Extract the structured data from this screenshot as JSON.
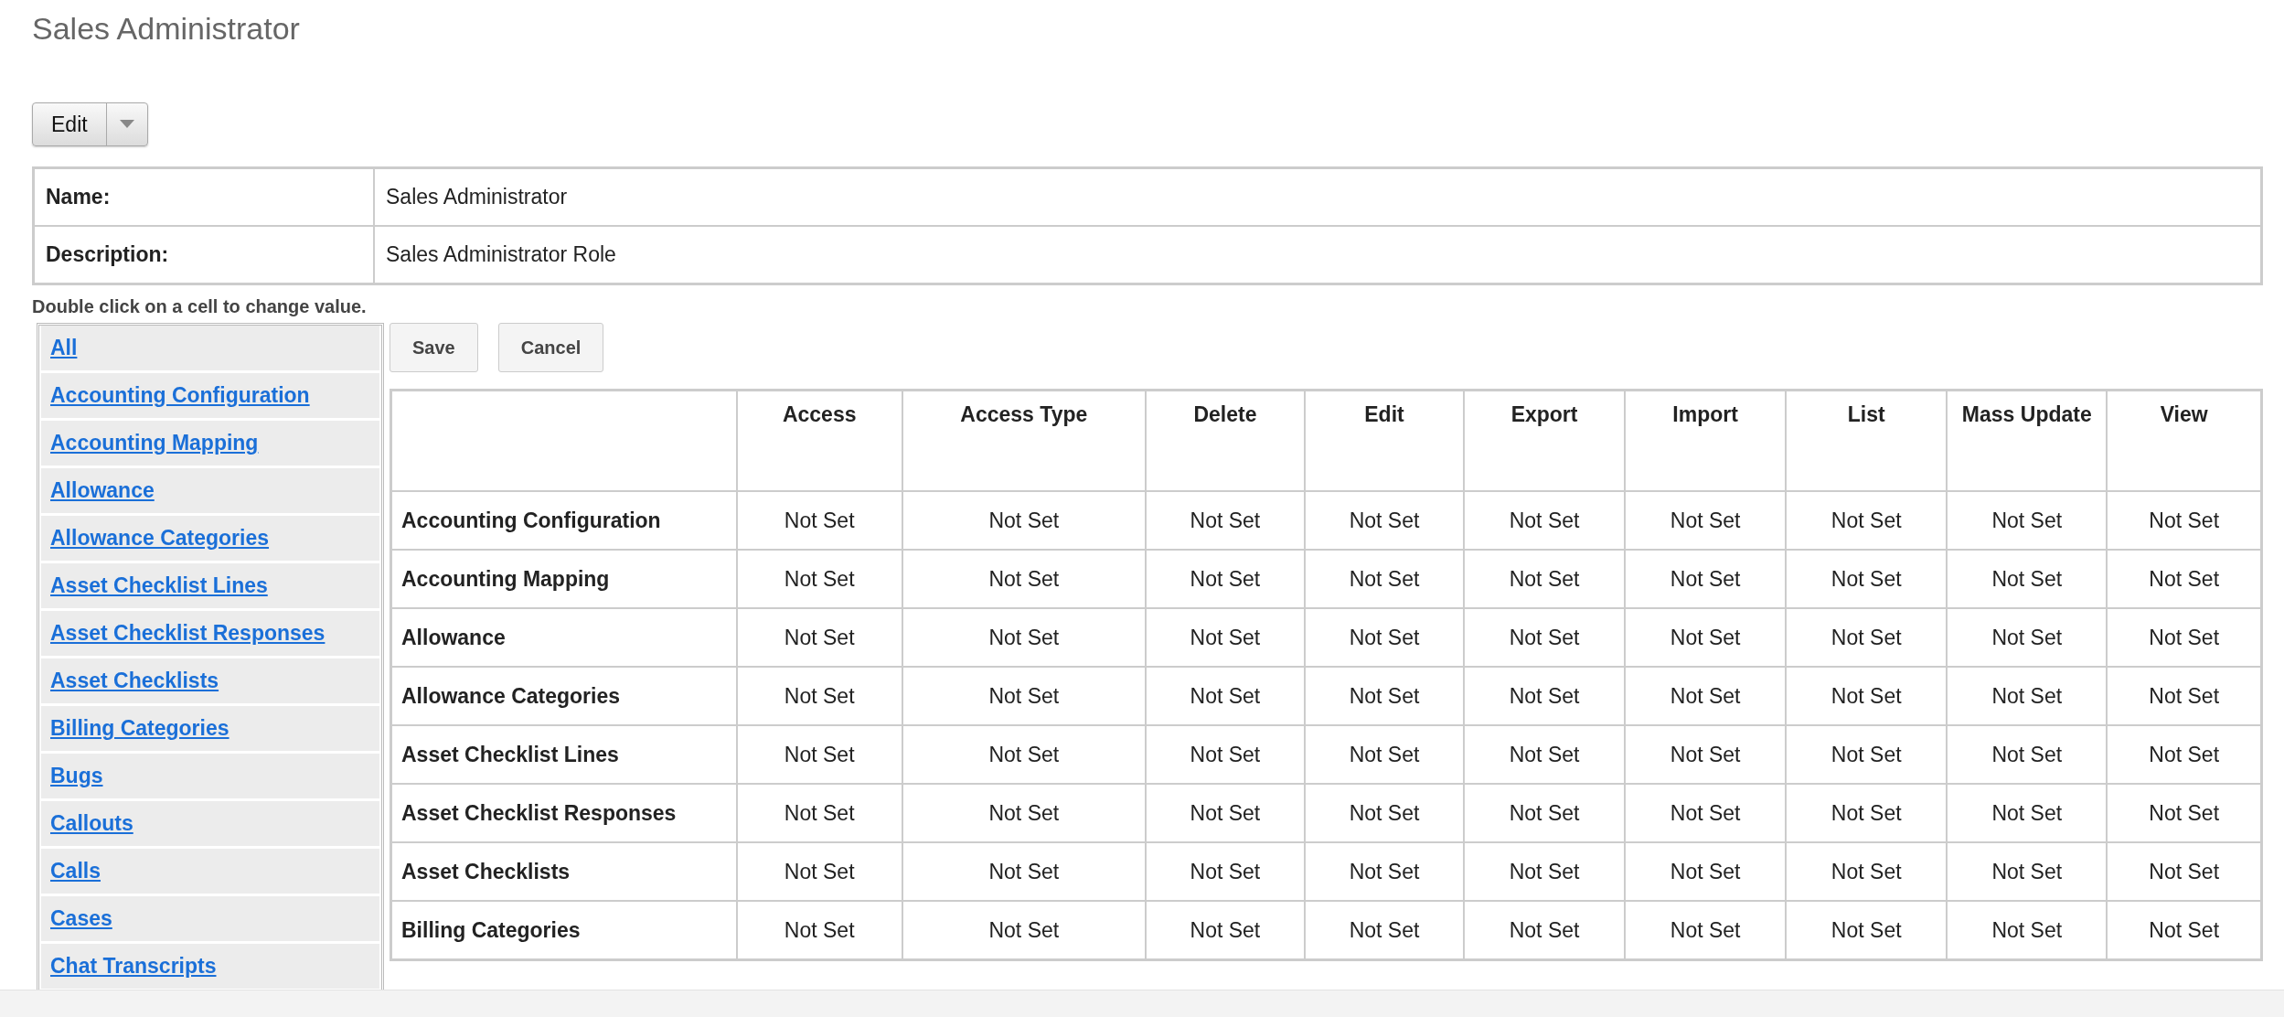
{
  "page_title": "Sales Administrator",
  "edit_button": "Edit",
  "details": [
    {
      "label": "Name:",
      "value": "Sales Administrator"
    },
    {
      "label": "Description:",
      "value": "Sales Administrator Role"
    }
  ],
  "hint": "Double click on a cell to change value.",
  "modules": [
    "All",
    "Accounting Configuration",
    "Accounting Mapping",
    "Allowance",
    "Allowance Categories",
    "Asset Checklist Lines",
    "Asset Checklist Responses",
    "Asset Checklists",
    "Billing Categories",
    "Bugs",
    "Callouts",
    "Calls",
    "Cases",
    "Chat Transcripts"
  ],
  "buttons": [
    "Save",
    "Cancel"
  ],
  "grid": {
    "columns": [
      "Access",
      "Access Type",
      "Delete",
      "Edit",
      "Export",
      "Import",
      "List",
      "Mass Update",
      "View"
    ],
    "rows": [
      {
        "name": "Accounting Configuration",
        "values": [
          "Not Set",
          "Not Set",
          "Not Set",
          "Not Set",
          "Not Set",
          "Not Set",
          "Not Set",
          "Not Set",
          "Not Set"
        ]
      },
      {
        "name": "Accounting Mapping",
        "values": [
          "Not Set",
          "Not Set",
          "Not Set",
          "Not Set",
          "Not Set",
          "Not Set",
          "Not Set",
          "Not Set",
          "Not Set"
        ]
      },
      {
        "name": "Allowance",
        "values": [
          "Not Set",
          "Not Set",
          "Not Set",
          "Not Set",
          "Not Set",
          "Not Set",
          "Not Set",
          "Not Set",
          "Not Set"
        ]
      },
      {
        "name": "Allowance Categories",
        "values": [
          "Not Set",
          "Not Set",
          "Not Set",
          "Not Set",
          "Not Set",
          "Not Set",
          "Not Set",
          "Not Set",
          "Not Set"
        ]
      },
      {
        "name": "Asset Checklist Lines",
        "values": [
          "Not Set",
          "Not Set",
          "Not Set",
          "Not Set",
          "Not Set",
          "Not Set",
          "Not Set",
          "Not Set",
          "Not Set"
        ]
      },
      {
        "name": "Asset Checklist Responses",
        "values": [
          "Not Set",
          "Not Set",
          "Not Set",
          "Not Set",
          "Not Set",
          "Not Set",
          "Not Set",
          "Not Set",
          "Not Set"
        ]
      },
      {
        "name": "Asset Checklists",
        "values": [
          "Not Set",
          "Not Set",
          "Not Set",
          "Not Set",
          "Not Set",
          "Not Set",
          "Not Set",
          "Not Set",
          "Not Set"
        ]
      },
      {
        "name": "Billing Categories",
        "values": [
          "Not Set",
          "Not Set",
          "Not Set",
          "Not Set",
          "Not Set",
          "Not Set",
          "Not Set",
          "Not Set",
          "Not Set"
        ]
      }
    ]
  }
}
